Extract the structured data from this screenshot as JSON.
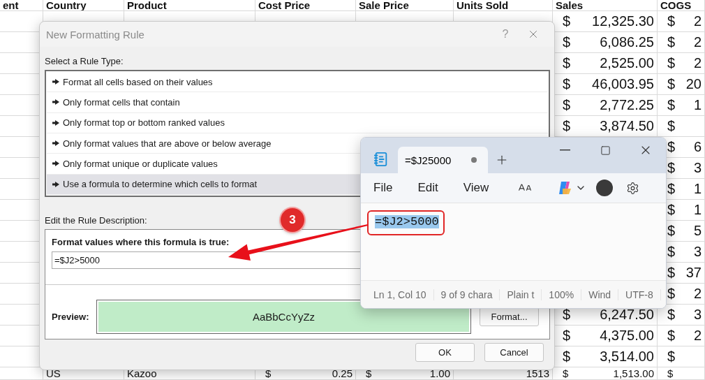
{
  "sheet": {
    "columns": [
      {
        "label": "ent",
        "kind": "text"
      },
      {
        "label": "Country",
        "kind": "text"
      },
      {
        "label": "Product",
        "kind": "text"
      },
      {
        "label": "Cost Price",
        "kind": "currency"
      },
      {
        "label": "Sale Price",
        "kind": "currency"
      },
      {
        "label": "Units Sold",
        "kind": "number"
      },
      {
        "label": "Sales",
        "kind": "currency"
      },
      {
        "label": "COGS",
        "kind": "currency"
      }
    ],
    "rows": [
      {
        "sales": {
          "symbol": "$",
          "amount": "12,325.30"
        },
        "cogs": {
          "symbol": "$",
          "amount": "2"
        }
      },
      {
        "sales": {
          "symbol": "$",
          "amount": "6,086.25"
        },
        "cogs": {
          "symbol": "$",
          "amount": "2"
        }
      },
      {
        "sales": {
          "symbol": "$",
          "amount": "2,525.00"
        },
        "cogs": {
          "symbol": "$",
          "amount": "2"
        }
      },
      {
        "sales": {
          "symbol": "$",
          "amount": "46,003.95"
        },
        "cogs": {
          "symbol": "$",
          "amount": "20"
        }
      },
      {
        "sales": {
          "symbol": "$",
          "amount": "2,772.25"
        },
        "cogs": {
          "symbol": "$",
          "amount": "1"
        }
      },
      {
        "sales": {
          "symbol": "$",
          "amount": "3,874.50"
        },
        "cogs": {
          "symbol": "$"
        }
      },
      {
        "cogs": {
          "symbol": "$",
          "amount": "6"
        }
      },
      {
        "cogs": {
          "symbol": "$",
          "amount": "3"
        }
      },
      {
        "cogs": {
          "symbol": "$",
          "amount": "1"
        }
      },
      {
        "cogs": {
          "symbol": "$",
          "amount": "1"
        }
      },
      {
        "cogs": {
          "symbol": "$",
          "amount": "5"
        }
      },
      {
        "cogs": {
          "symbol": "$",
          "amount": "3"
        }
      },
      {
        "cogs": {
          "symbol": "$",
          "amount": "37"
        }
      },
      {
        "cogs": {
          "symbol": "$",
          "amount": "2"
        }
      },
      {
        "sales": {
          "symbol": "$",
          "amount": "6,247.50"
        },
        "cogs": {
          "symbol": "$",
          "amount": "3"
        }
      },
      {
        "sales": {
          "symbol": "$",
          "amount": "4,375.00"
        },
        "cogs": {
          "symbol": "$",
          "amount": "2"
        }
      },
      {
        "sales": {
          "symbol": "$",
          "amount": "3,514.00"
        },
        "cogs": {
          "symbol": "$"
        }
      },
      {
        "country": "US",
        "product": "Kazoo",
        "cost_price": {
          "symbol": "$",
          "amount": "0.25"
        },
        "sale_price": {
          "symbol": "$",
          "amount": "1.00"
        },
        "units_sold": "1513",
        "sales": {
          "symbol": "$",
          "amount": "1,513.00"
        },
        "cogs": {
          "symbol": "$"
        }
      }
    ]
  },
  "dialog": {
    "title": "New Formatting Rule",
    "help_label": "?",
    "rule_type_label": "Select a Rule Type:",
    "rule_types": [
      {
        "label": "Format all cells based on their values",
        "selected": false
      },
      {
        "label": "Only format cells that contain",
        "selected": false
      },
      {
        "label": "Only format top or bottom ranked values",
        "selected": false
      },
      {
        "label": "Only format values that are above or below average",
        "selected": false
      },
      {
        "label": "Only format unique or duplicate values",
        "selected": false
      },
      {
        "label": "Use a formula to determine which cells to format",
        "selected": true
      }
    ],
    "description_label": "Edit the Rule Description:",
    "formula_label": "Format values where this formula is true:",
    "formula_value": "=$J2>5000",
    "preview_label": "Preview:",
    "preview_sample": "AaBbCcYyZz",
    "format_button": "Format...",
    "buttons": [
      "OK",
      "Cancel"
    ]
  },
  "notepad": {
    "tabs": [
      {
        "label": "=$J25000",
        "modified": true,
        "selected": true
      }
    ],
    "menu": [
      "File",
      "Edit",
      "View"
    ],
    "content": "=$J2>5000",
    "status_bar": [
      "Ln 1, Col 10",
      "9 of 9 chara",
      "Plain t",
      "100%",
      "Wind",
      "UTF-8"
    ]
  },
  "annotation": {
    "step": "3"
  }
}
